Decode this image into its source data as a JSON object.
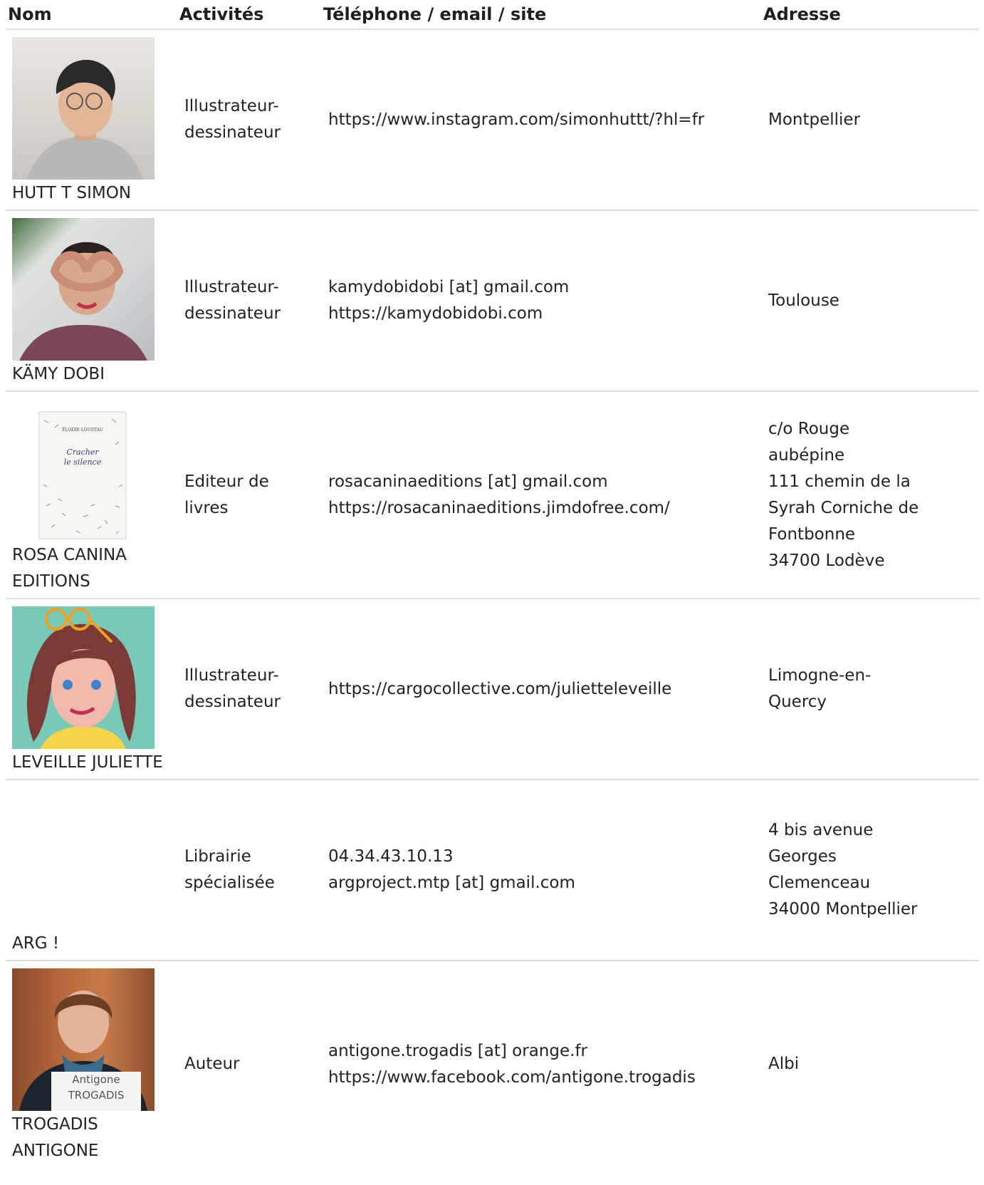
{
  "headers": {
    "nom": "Nom",
    "activites": "Activités",
    "contact": "Téléphone / email / site",
    "adresse": "Adresse"
  },
  "rows": [
    {
      "name": [
        "HUTT T SIMON"
      ],
      "activity": [
        "Illustrateur-",
        "dessinateur"
      ],
      "contact": [
        "https://www.instagram.com/simonhuttt/?hl=fr"
      ],
      "address": [
        "Montpellier"
      ],
      "photo": "portrait-photo"
    },
    {
      "name": [
        "KÄMY DOBI"
      ],
      "activity": [
        "Illustrateur-",
        "dessinateur"
      ],
      "contact": [
        "kamydobidobi [at] gmail.com",
        "https://kamydobidobi.com"
      ],
      "address": [
        "Toulouse"
      ],
      "photo": "portrait-photo"
    },
    {
      "name": [
        "ROSA CANINA",
        "EDITIONS"
      ],
      "activity": [
        "Editeur de",
        "livres"
      ],
      "contact": [
        "rosacaninaeditions [at] gmail.com",
        "https://rosacaninaeditions.jimdofree.com/"
      ],
      "address": [
        "c/o Rouge",
        "aubépine",
        "111 chemin de la",
        "Syrah Corniche de",
        "Fontbonne",
        "34700 Lodève"
      ],
      "photo": "book-cover",
      "cover": {
        "author": "ÉLODIE LOUSTAU",
        "title1": "Cracher",
        "title2": "le silence"
      }
    },
    {
      "name": [
        "LEVEILLE JULIETTE"
      ],
      "activity": [
        "Illustrateur-",
        "dessinateur"
      ],
      "contact": [
        "https://cargocollective.com/julietteleveille"
      ],
      "address": [
        "Limogne-en-",
        "Quercy"
      ],
      "photo": "illustration"
    },
    {
      "name": [
        "ARG !"
      ],
      "activity": [
        "Librairie",
        "spécialisée"
      ],
      "contact": [
        "04.34.43.10.13",
        "argproject.mtp [at] gmail.com"
      ],
      "address": [
        "4 bis avenue",
        "Georges",
        "Clemenceau",
        "34000 Montpellier"
      ],
      "photo": ""
    },
    {
      "name": [
        "TROGADIS",
        "ANTIGONE"
      ],
      "activity": [
        "Auteur"
      ],
      "contact": [
        "antigone.trogadis [at] orange.fr",
        "https://www.facebook.com/antigone.trogadis"
      ],
      "address": [
        "Albi"
      ],
      "photo": "portrait-photo",
      "card": [
        "Antigone",
        "TROGADIS"
      ]
    }
  ],
  "colors": {
    "text": "#222222",
    "border": "#dddddd",
    "juliette_bg": "#79c9b8"
  }
}
